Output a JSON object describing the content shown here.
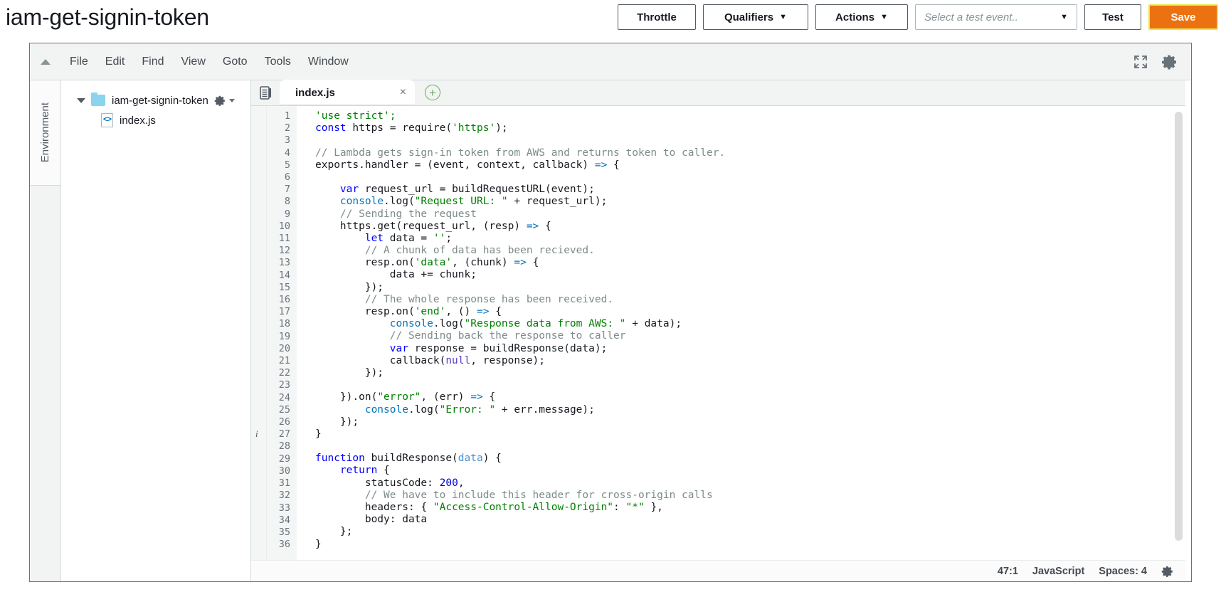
{
  "header": {
    "function_name": "iam-get-signin-token",
    "throttle_label": "Throttle",
    "qualifiers_label": "Qualifiers",
    "actions_label": "Actions",
    "test_event_placeholder": "Select a test event..",
    "test_label": "Test",
    "save_label": "Save",
    "caret_glyph": "▼",
    "save_bg": "#ec7211",
    "save_border": "#e8e84a"
  },
  "menubar": {
    "items": [
      "File",
      "Edit",
      "Find",
      "View",
      "Goto",
      "Tools",
      "Window"
    ]
  },
  "environment": {
    "tab_label": "Environment"
  },
  "filetree": {
    "root_label": "iam-get-signin-token",
    "file_label": "index.js"
  },
  "tabs": {
    "active_label": "index.js",
    "close_glyph": "×",
    "add_glyph": "+"
  },
  "editor": {
    "annotation_line": 27,
    "annotation_glyph": "i",
    "first_line": 1,
    "last_line": 36,
    "lines": [
      {
        "n": 1,
        "tokens": [
          {
            "t": "'use strict';",
            "c": "str"
          }
        ]
      },
      {
        "n": 2,
        "tokens": [
          {
            "t": "const",
            "c": "kw"
          },
          {
            "t": " https = ",
            "c": "idn"
          },
          {
            "t": "require(",
            "c": "idn"
          },
          {
            "t": "'https'",
            "c": "str"
          },
          {
            "t": ");",
            "c": "idn"
          }
        ]
      },
      {
        "n": 3,
        "tokens": []
      },
      {
        "n": 4,
        "tokens": [
          {
            "t": "// Lambda gets sign-in token from AWS and returns token to caller.",
            "c": "cmt"
          }
        ]
      },
      {
        "n": 5,
        "tokens": [
          {
            "t": "exports.handler = (event, context, callback) ",
            "c": "idn"
          },
          {
            "t": "=>",
            "c": "arrow"
          },
          {
            "t": " {",
            "c": "idn"
          }
        ]
      },
      {
        "n": 6,
        "tokens": []
      },
      {
        "n": 7,
        "tokens": [
          {
            "t": "    ",
            "c": "idn"
          },
          {
            "t": "var",
            "c": "kw"
          },
          {
            "t": " request_url = buildRequestURL(event);",
            "c": "idn"
          }
        ]
      },
      {
        "n": 8,
        "tokens": [
          {
            "t": "    ",
            "c": "idn"
          },
          {
            "t": "console",
            "c": "cls"
          },
          {
            "t": ".log(",
            "c": "idn"
          },
          {
            "t": "\"Request URL: \"",
            "c": "str"
          },
          {
            "t": " + request_url);",
            "c": "idn"
          }
        ]
      },
      {
        "n": 9,
        "tokens": [
          {
            "t": "    ",
            "c": "idn"
          },
          {
            "t": "// Sending the request",
            "c": "cmt"
          }
        ]
      },
      {
        "n": 10,
        "tokens": [
          {
            "t": "    https.get(request_url, (resp) ",
            "c": "idn"
          },
          {
            "t": "=>",
            "c": "arrow"
          },
          {
            "t": " {",
            "c": "idn"
          }
        ]
      },
      {
        "n": 11,
        "tokens": [
          {
            "t": "        ",
            "c": "idn"
          },
          {
            "t": "let",
            "c": "kw"
          },
          {
            "t": " data = ",
            "c": "idn"
          },
          {
            "t": "''",
            "c": "str"
          },
          {
            "t": ";",
            "c": "idn"
          }
        ]
      },
      {
        "n": 12,
        "tokens": [
          {
            "t": "        ",
            "c": "idn"
          },
          {
            "t": "// A chunk of data has been recieved.",
            "c": "cmt"
          }
        ]
      },
      {
        "n": 13,
        "tokens": [
          {
            "t": "        resp.on(",
            "c": "idn"
          },
          {
            "t": "'data'",
            "c": "str"
          },
          {
            "t": ", (chunk) ",
            "c": "idn"
          },
          {
            "t": "=>",
            "c": "arrow"
          },
          {
            "t": " {",
            "c": "idn"
          }
        ]
      },
      {
        "n": 14,
        "tokens": [
          {
            "t": "            data += chunk;",
            "c": "idn"
          }
        ]
      },
      {
        "n": 15,
        "tokens": [
          {
            "t": "        });",
            "c": "idn"
          }
        ]
      },
      {
        "n": 16,
        "tokens": [
          {
            "t": "        ",
            "c": "idn"
          },
          {
            "t": "// The whole response has been received.",
            "c": "cmt"
          }
        ]
      },
      {
        "n": 17,
        "tokens": [
          {
            "t": "        resp.on(",
            "c": "idn"
          },
          {
            "t": "'end'",
            "c": "str"
          },
          {
            "t": ", () ",
            "c": "idn"
          },
          {
            "t": "=>",
            "c": "arrow"
          },
          {
            "t": " {",
            "c": "idn"
          }
        ]
      },
      {
        "n": 18,
        "tokens": [
          {
            "t": "            ",
            "c": "idn"
          },
          {
            "t": "console",
            "c": "cls"
          },
          {
            "t": ".log(",
            "c": "idn"
          },
          {
            "t": "\"Response data from AWS: \"",
            "c": "str"
          },
          {
            "t": " + data);",
            "c": "idn"
          }
        ]
      },
      {
        "n": 19,
        "tokens": [
          {
            "t": "            ",
            "c": "idn"
          },
          {
            "t": "// Sending back the response to caller",
            "c": "cmt"
          }
        ]
      },
      {
        "n": 20,
        "tokens": [
          {
            "t": "            ",
            "c": "idn"
          },
          {
            "t": "var",
            "c": "kw"
          },
          {
            "t": " response = buildResponse(data);",
            "c": "idn"
          }
        ]
      },
      {
        "n": 21,
        "tokens": [
          {
            "t": "            callback(",
            "c": "idn"
          },
          {
            "t": "null",
            "c": "kw2"
          },
          {
            "t": ", response);",
            "c": "idn"
          }
        ]
      },
      {
        "n": 22,
        "tokens": [
          {
            "t": "        });",
            "c": "idn"
          }
        ]
      },
      {
        "n": 23,
        "tokens": []
      },
      {
        "n": 24,
        "tokens": [
          {
            "t": "    }).on(",
            "c": "idn"
          },
          {
            "t": "\"error\"",
            "c": "str"
          },
          {
            "t": ", (err) ",
            "c": "idn"
          },
          {
            "t": "=>",
            "c": "arrow"
          },
          {
            "t": " {",
            "c": "idn"
          }
        ]
      },
      {
        "n": 25,
        "tokens": [
          {
            "t": "        ",
            "c": "idn"
          },
          {
            "t": "console",
            "c": "cls"
          },
          {
            "t": ".log(",
            "c": "idn"
          },
          {
            "t": "\"Error: \"",
            "c": "str"
          },
          {
            "t": " + err.message);",
            "c": "idn"
          }
        ]
      },
      {
        "n": 26,
        "tokens": [
          {
            "t": "    });",
            "c": "idn"
          }
        ]
      },
      {
        "n": 27,
        "tokens": [
          {
            "t": "}",
            "c": "idn"
          }
        ]
      },
      {
        "n": 28,
        "tokens": []
      },
      {
        "n": 29,
        "tokens": [
          {
            "t": "function",
            "c": "kw"
          },
          {
            "t": " buildResponse(",
            "c": "idn"
          },
          {
            "t": "data",
            "c": "param"
          },
          {
            "t": ") {",
            "c": "idn"
          }
        ]
      },
      {
        "n": 30,
        "tokens": [
          {
            "t": "    ",
            "c": "idn"
          },
          {
            "t": "return",
            "c": "kw"
          },
          {
            "t": " {",
            "c": "idn"
          }
        ]
      },
      {
        "n": 31,
        "tokens": [
          {
            "t": "        statusCode: ",
            "c": "idn"
          },
          {
            "t": "200",
            "c": "num"
          },
          {
            "t": ",",
            "c": "idn"
          }
        ]
      },
      {
        "n": 32,
        "tokens": [
          {
            "t": "        ",
            "c": "idn"
          },
          {
            "t": "// We have to include this header for cross-origin calls",
            "c": "cmt"
          }
        ]
      },
      {
        "n": 33,
        "tokens": [
          {
            "t": "        headers: { ",
            "c": "idn"
          },
          {
            "t": "\"Access-Control-Allow-Origin\"",
            "c": "str"
          },
          {
            "t": ": ",
            "c": "idn"
          },
          {
            "t": "\"*\"",
            "c": "str"
          },
          {
            "t": " },",
            "c": "idn"
          }
        ]
      },
      {
        "n": 34,
        "tokens": [
          {
            "t": "        body: data",
            "c": "idn"
          }
        ]
      },
      {
        "n": 35,
        "tokens": [
          {
            "t": "    };",
            "c": "idn"
          }
        ]
      },
      {
        "n": 36,
        "tokens": [
          {
            "t": "}",
            "c": "idn"
          }
        ]
      }
    ]
  },
  "statusbar": {
    "cursor_position": "47:1",
    "language": "JavaScript",
    "indent": "Spaces: 4"
  }
}
